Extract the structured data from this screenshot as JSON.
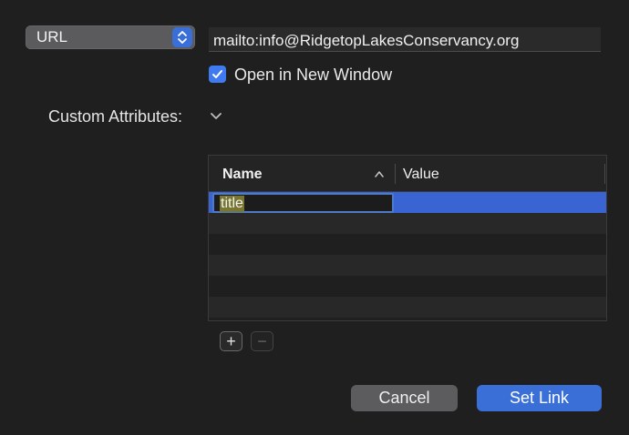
{
  "link_type": {
    "selected": "URL"
  },
  "url_field": {
    "value": "mailto:info@RidgetopLakesConservancy.org"
  },
  "open_new_window": {
    "label": "Open in New Window",
    "checked": true
  },
  "custom_attributes": {
    "label": "Custom Attributes:"
  },
  "attributes_table": {
    "columns": [
      "Name",
      "Value"
    ],
    "sort_column": "Name",
    "sort_direction": "ascending",
    "rows": [
      {
        "name": "title",
        "value": ""
      }
    ]
  },
  "buttons": {
    "add": "+",
    "remove": "−",
    "cancel": "Cancel",
    "set_link": "Set Link"
  },
  "colors": {
    "accent": "#3b6fd8",
    "selection": "#3b64d3",
    "background": "#1f1f1f"
  }
}
